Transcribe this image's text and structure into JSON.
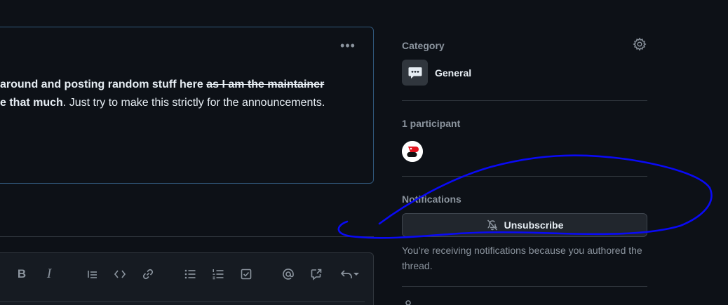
{
  "comment": {
    "line1_bold": "around and posting random stuff here ",
    "line1_strike": "as I am the maintainer",
    "line2_bold": "e that much",
    "line2_rest": ". Just try to make this strictly for the announcements."
  },
  "toolbar": {
    "bold_label": "B",
    "italic_label": "I"
  },
  "sidebar": {
    "category_label": "Category",
    "category_name": "General",
    "participants_label": "1 participant",
    "notifications_label": "Notifications",
    "unsubscribe_label": "Unsubscribe",
    "notifications_text": "You’re receiving notifications because you authored the thread."
  },
  "annotation": {
    "color": "#0a0af5"
  }
}
